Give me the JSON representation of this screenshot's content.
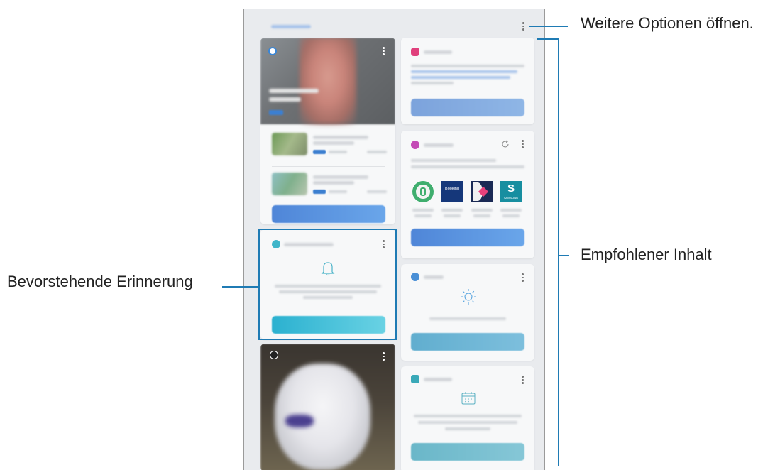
{
  "callouts": {
    "more_options": "Weitere Optionen öffnen.",
    "recommended_content": "Empfohlener Inhalt",
    "upcoming_reminder": "Bevorstehende Erinnerung"
  },
  "colors": {
    "callout_line": "#1f7bb4",
    "reminder_highlight": "#1f7bb4",
    "panel_background": "#e9ebee"
  },
  "icons": {
    "more_options": "more-vertical-icon",
    "refresh": "refresh-icon",
    "reminder": "bell-icon",
    "weather": "sun-icon",
    "calendar": "calendar-icon"
  },
  "apps": {
    "booking_label": "Booking",
    "samsung_label": "SAMSUNG"
  }
}
